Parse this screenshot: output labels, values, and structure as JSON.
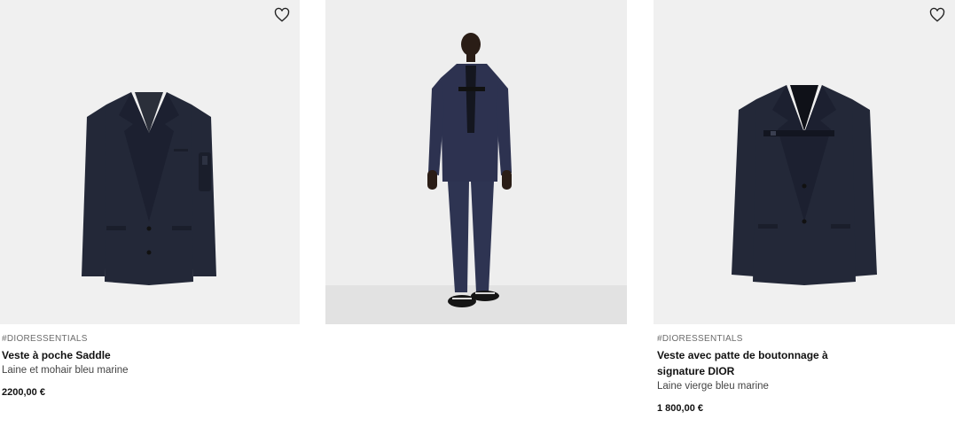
{
  "products": [
    {
      "tag": "#DIORESSENTIALS",
      "name": "Veste à poche Saddle",
      "description": "Laine et mohair bleu marine",
      "price": "2200,00 €",
      "favorite_icon": "heart-outline-icon"
    },
    {
      "image": "model-wearing-suit"
    },
    {
      "tag": "#DIORESSENTIALS",
      "name": "Veste avec patte de boutonnage à signature DIOR",
      "description": "Laine vierge bleu marine",
      "price": "1 800,00 €",
      "favorite_icon": "heart-outline-icon"
    }
  ],
  "colors": {
    "image_background": "#f0f0f0",
    "jacket_navy": "#232838",
    "text_primary": "#111111",
    "text_muted": "#6b6b6b"
  }
}
